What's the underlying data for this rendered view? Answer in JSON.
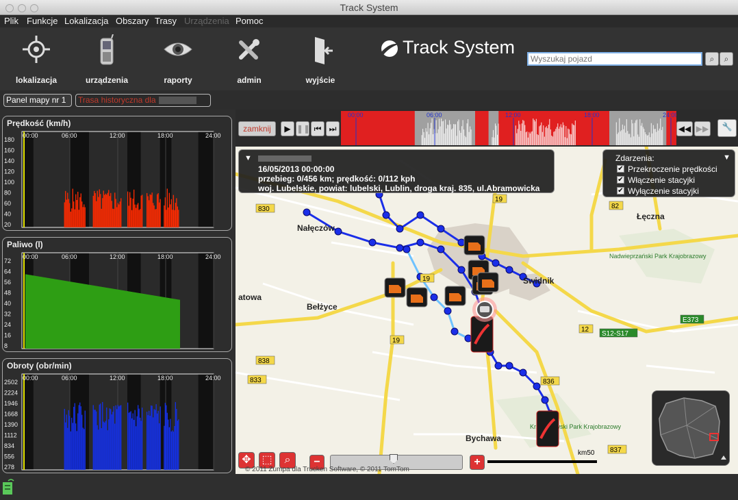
{
  "window": {
    "title": "Track System"
  },
  "menu": [
    "Plik",
    "Funkcje",
    "Lokalizacja",
    "Obszary",
    "Trasy",
    "Urządzenia",
    "Pomoc"
  ],
  "menu_disabled_index": 5,
  "toolbar": {
    "items": [
      {
        "label": "lokalizacja",
        "icon": "crosshair-icon"
      },
      {
        "label": "urządzenia",
        "icon": "mobile-phone-icon"
      },
      {
        "label": "raporty",
        "icon": "eye-icon"
      },
      {
        "label": "admin",
        "icon": "tools-icon"
      },
      {
        "label": "wyjście",
        "icon": "exit-door-icon"
      }
    ]
  },
  "logo": {
    "text": "Track System"
  },
  "search": {
    "placeholder": "Wyszukaj pojazd"
  },
  "tabs": [
    {
      "label": "Panel mapy nr 1",
      "active": true
    },
    {
      "label": "Trasa historyczna dla",
      "active": false
    }
  ],
  "panels": [
    {
      "title": "Prędkość (km/h)",
      "y_ticks": [
        "180",
        "160",
        "140",
        "120",
        "100",
        "80",
        "60",
        "40",
        "20"
      ],
      "x_ticks": [
        "00:00",
        "06:00",
        "12:00",
        "18:00",
        "24:00"
      ],
      "fill_color": "#ff2a00"
    },
    {
      "title": "Paliwo (l)",
      "y_ticks": [
        "72",
        "64",
        "56",
        "48",
        "40",
        "32",
        "24",
        "16",
        "8"
      ],
      "x_ticks": [
        "00:00",
        "06:00",
        "12:00",
        "18:00",
        "24:00"
      ],
      "fill_color": "#2e9e14"
    },
    {
      "title": "Obroty (obr/min)",
      "y_ticks": [
        "2502",
        "2224",
        "1946",
        "1668",
        "1390",
        "1112",
        "834",
        "556",
        "278"
      ],
      "x_ticks": [
        "00:00",
        "06:00",
        "12:00",
        "18:00",
        "24:00"
      ],
      "fill_color": "#1430e6"
    }
  ],
  "player": {
    "close_label": "zamknij",
    "timeline_ticks": [
      "00:00",
      "06:00",
      "12:00",
      "18:00",
      "24:00"
    ]
  },
  "info": {
    "datetime": "16/05/2013 00:00:00",
    "stats": "przebieg: 0/456 km;  prędkość: 0/112 kph",
    "location": "woj. Lubelskie, powiat: lubelski, Lublin, droga kraj. 835, ul.Abramowicka"
  },
  "events": {
    "title": "Zdarzenia:",
    "items": [
      {
        "label": "Przekroczenie prędkości",
        "checked": true
      },
      {
        "label": "Włączenie stacyjki",
        "checked": true
      },
      {
        "label": "Wyłączenie stacyjki",
        "checked": true
      }
    ]
  },
  "map": {
    "places": [
      {
        "name": "Nałęczów",
        "x": 90,
        "y": 123
      },
      {
        "name": "Łęczna",
        "x": 586,
        "y": 106
      },
      {
        "name": "Świdnik",
        "x": 420,
        "y": 200
      },
      {
        "name": "Bełżyce",
        "x": 104,
        "y": 238
      },
      {
        "name": "atowa",
        "x": 4,
        "y": 224
      },
      {
        "name": "Bychawa",
        "x": 336,
        "y": 430
      },
      {
        "name": "Nadwieprzański Park Krajobrazowy",
        "x": 546,
        "y": 163
      },
      {
        "name": "Krzczonowski Park Krajobrazowy",
        "x": 430,
        "y": 412
      }
    ],
    "road_labels": [
      "830",
      "19",
      "82",
      "19",
      "19",
      "E373",
      "12",
      "S12-S17",
      "833",
      "836",
      "837",
      "838"
    ],
    "scale_label": "km50",
    "copyright": "© 2011 Zumpa dla Trucken Software, © 2011 TomTom"
  }
}
